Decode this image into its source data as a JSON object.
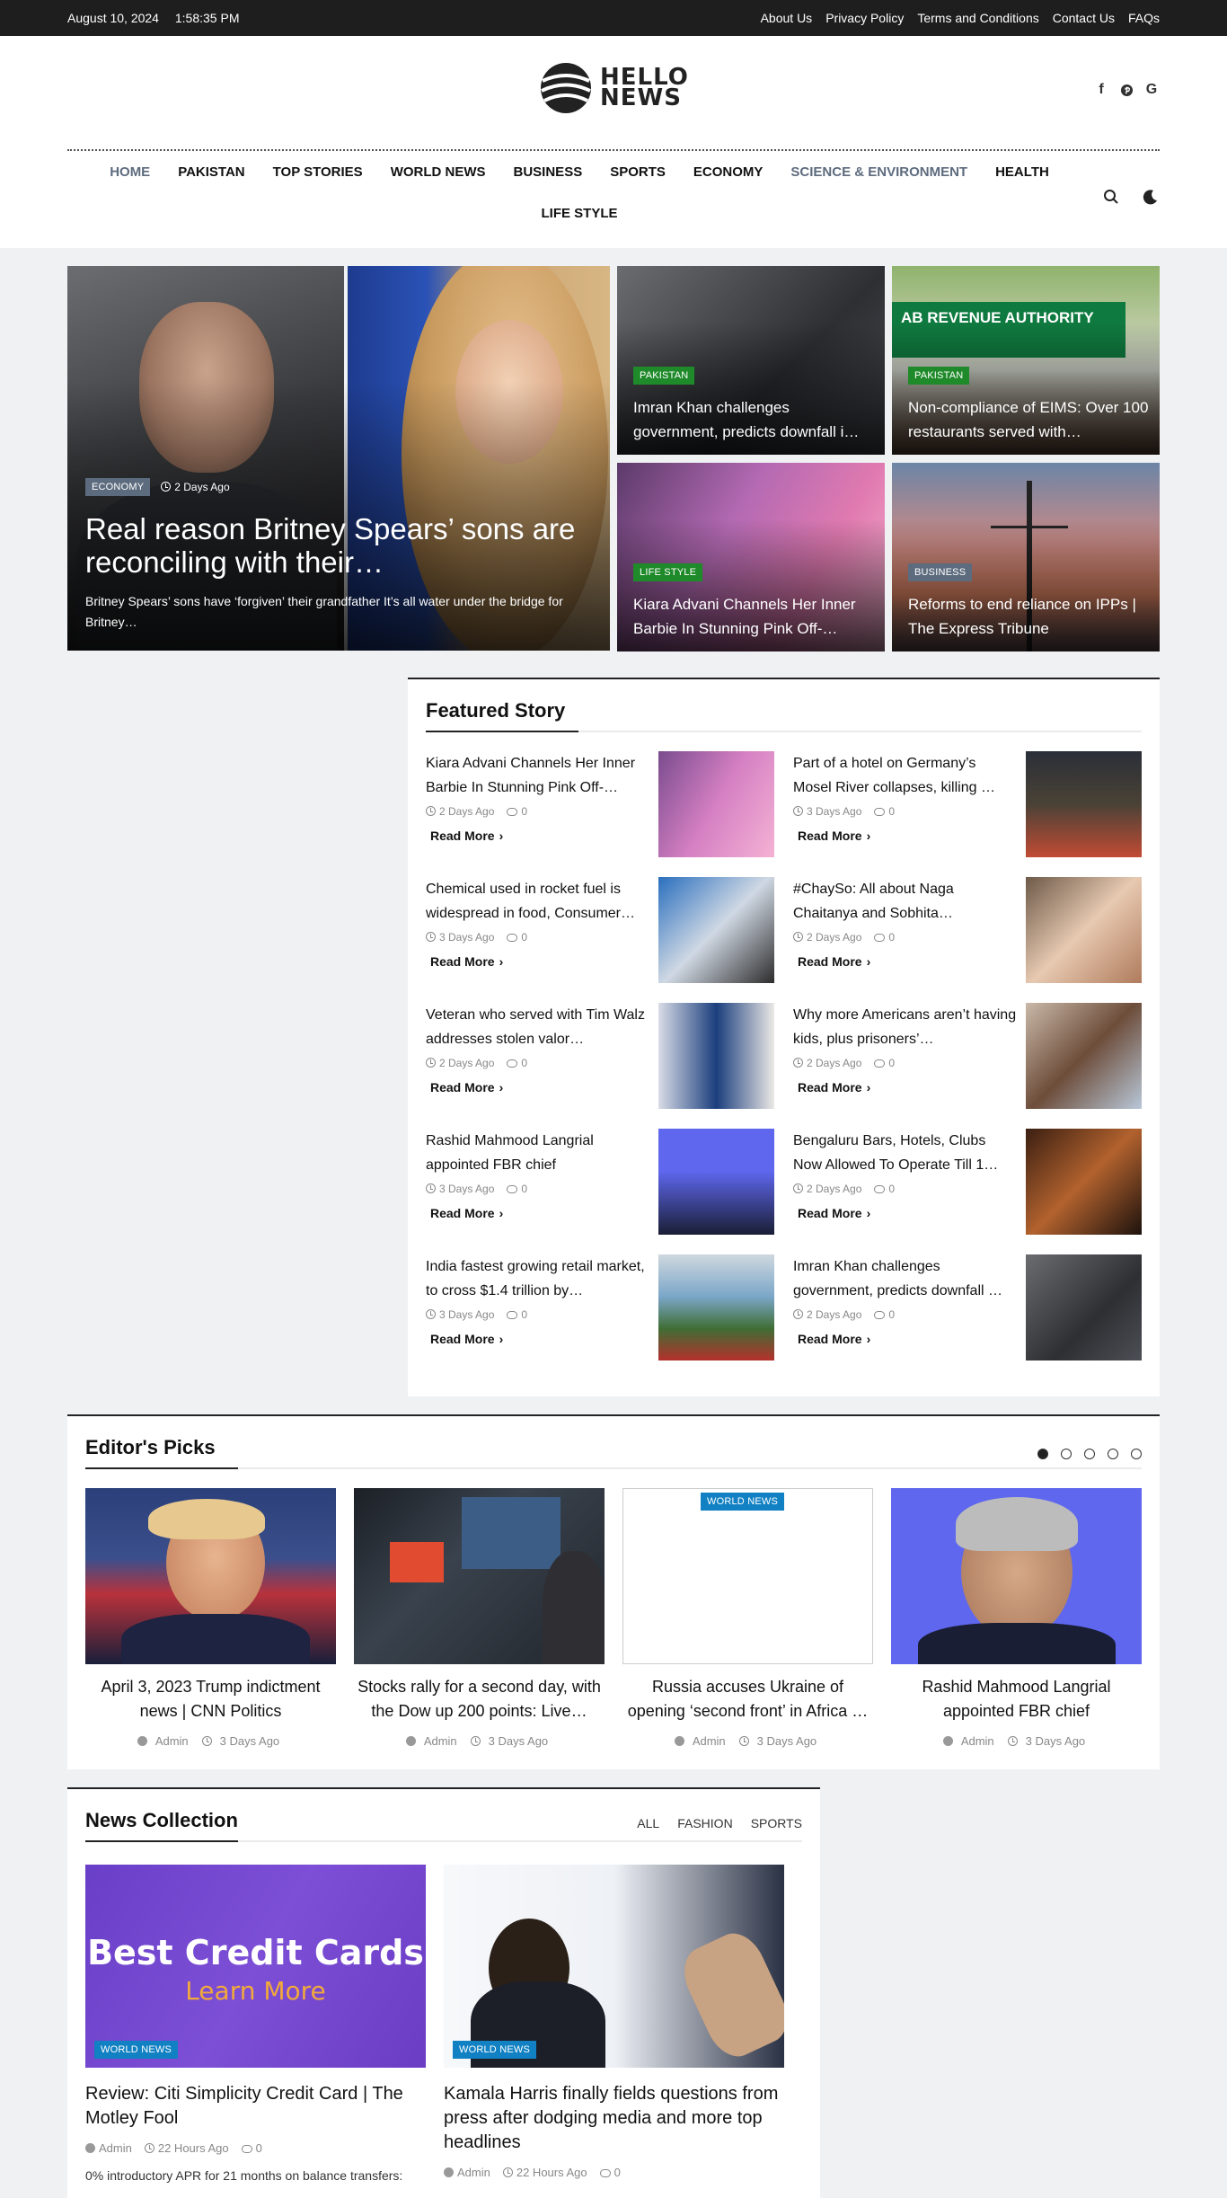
{
  "topbar": {
    "date": "August 10, 2024",
    "time": "1:58:35 PM",
    "links": [
      "About Us",
      "Privacy Policy",
      "Terms and Conditions",
      "Contact Us",
      "FAQs"
    ]
  },
  "brand": {
    "line1": "HELLO",
    "line2": "NEWS"
  },
  "social": [
    "facebook-icon",
    "pinterest-icon",
    "google-icon"
  ],
  "nav": {
    "items": [
      "HOME",
      "PAKISTAN",
      "TOP STORIES",
      "WORLD NEWS",
      "BUSINESS",
      "SPORTS",
      "ECONOMY",
      "SCIENCE & ENVIRONMENT",
      "HEALTH"
    ],
    "second_row": "LIFE STYLE"
  },
  "hero": {
    "category": "ECONOMY",
    "time": "2 Days Ago",
    "title": "Real reason Britney Spears’ sons are reconciling with their…",
    "excerpt": "Britney Spears’ sons have ‘forgiven’ their grandfather  It’s all water under the bridge for Britney…"
  },
  "tiles": [
    {
      "category": "PAKISTAN",
      "title": "Imran Khan challenges government, predicts downfall i…"
    },
    {
      "category": "PAKISTAN",
      "title": "Non-compliance of EIMS: Over 100 restaurants served with…",
      "sign": "AB REVENUE AUTHORITY"
    },
    {
      "category": "LIFE STYLE",
      "title": "Kiara Advani Channels Her Inner Barbie In Stunning Pink Off-…"
    },
    {
      "category": "BUSINESS",
      "title": "Reforms to end reliance on IPPs | The Express Tribune"
    }
  ],
  "featured": {
    "title": "Featured Story",
    "read_more": "Read More",
    "items": [
      {
        "title": "Kiara Advani Channels Her Inner Barbie In Stunning Pink Off-…",
        "time": "2 Days Ago",
        "comments": "0"
      },
      {
        "title": "Part of a hotel on Germany’s Mosel River collapses, killing …",
        "time": "3 Days Ago",
        "comments": "0"
      },
      {
        "title": "Chemical used in rocket fuel is widespread in food, Consumer…",
        "time": "3 Days Ago",
        "comments": "0"
      },
      {
        "title": "#ChaySo: All about Naga Chaitanya and Sobhita…",
        "time": "2 Days Ago",
        "comments": "0"
      },
      {
        "title": "Veteran who served with Tim Walz addresses stolen valor…",
        "time": "2 Days Ago",
        "comments": "0"
      },
      {
        "title": "Why more Americans aren’t having kids, plus prisoners’…",
        "time": "2 Days Ago",
        "comments": "0"
      },
      {
        "title": "Rashid Mahmood Langrial appointed FBR chief",
        "time": "3 Days Ago",
        "comments": "0"
      },
      {
        "title": "Bengaluru Bars, Hotels, Clubs Now Allowed To Operate Till 1…",
        "time": "2 Days Ago",
        "comments": "0"
      },
      {
        "title": "India fastest growing retail market, to cross $1.4 trillion by…",
        "time": "3 Days Ago",
        "comments": "0"
      },
      {
        "title": "Imran Khan challenges government, predicts downfall …",
        "time": "2 Days Ago",
        "comments": "0"
      }
    ]
  },
  "editors": {
    "title": "Editor's Picks",
    "cards": [
      {
        "title": "April 3, 2023 Trump indictment news | CNN Politics",
        "author": "Admin",
        "time": "3 Days Ago"
      },
      {
        "title": "Stocks rally for a second day, with the Dow up 200 points: Live…",
        "author": "Admin",
        "time": "3 Days Ago"
      },
      {
        "title": "Russia accuses Ukraine of opening ‘second front’ in Africa …",
        "author": "Admin",
        "time": "3 Days Ago",
        "category": "WORLD NEWS"
      },
      {
        "title": "Rashid Mahmood Langrial appointed FBR chief",
        "author": "Admin",
        "time": "3 Days Ago"
      }
    ]
  },
  "collection": {
    "title": "News Collection",
    "tabs": [
      "ALL",
      "FASHION",
      "SPORTS"
    ],
    "cards": [
      {
        "category": "WORLD NEWS",
        "title": "Review: Citi Simplicity Credit Card | The Motley Fool",
        "author": "Admin",
        "time": "22 Hours Ago",
        "comments": "0",
        "excerpt": "0% introductory APR for 21 months on balance transfers:",
        "ad_line1": "Best Credit Cards",
        "ad_line2": "Learn More"
      },
      {
        "category": "WORLD NEWS",
        "title": "Kamala Harris finally fields questions from press after dodging media and more top headlines",
        "author": "Admin",
        "time": "22 Hours Ago",
        "comments": "0"
      }
    ]
  }
}
